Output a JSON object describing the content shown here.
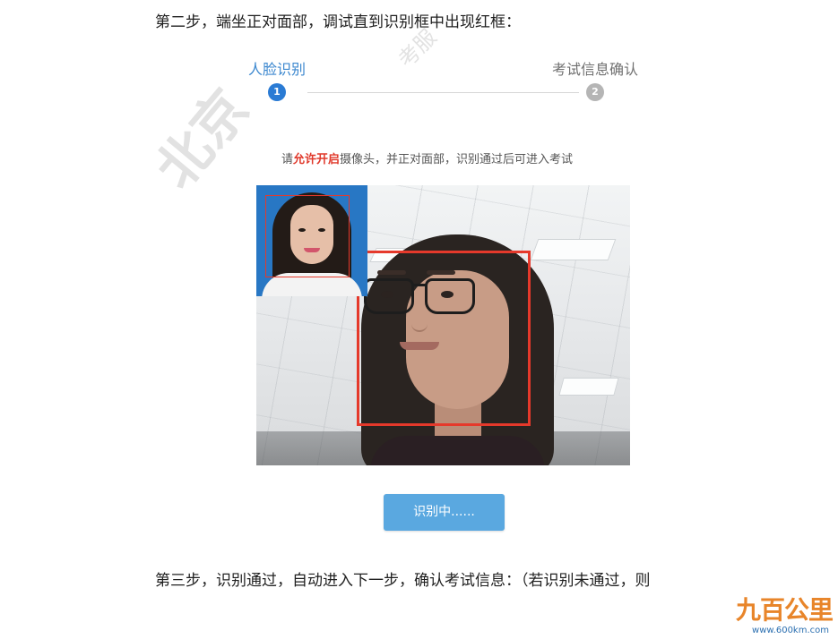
{
  "doc": {
    "step2_text": "第二步，端坐正对面部，调试直到识别框中出现红框：",
    "step3_text": "第三步，识别通过，自动进入下一步，确认考试信息：（若识别未通过，则"
  },
  "steps": {
    "step1": {
      "label": "人脸识别",
      "number": "1",
      "color": "#2a7bd4"
    },
    "step2": {
      "label": "考试信息确认",
      "number": "2",
      "color": "#b5b5b5"
    }
  },
  "instruction": {
    "prefix": "请",
    "highlight": "允许开启",
    "suffix": "摄像头，并正对面部，识别通过后可进入考试",
    "highlight_color": "#e0392b"
  },
  "button": {
    "label": "识别中......"
  },
  "watermark": {
    "main": "北京",
    "secondary": "考服"
  },
  "logo": {
    "main": "九百公里",
    "url": "www.600km.com"
  },
  "colors": {
    "accent": "#2a7bd4",
    "frame": "#e5392b",
    "button": "#5aa8e0"
  }
}
